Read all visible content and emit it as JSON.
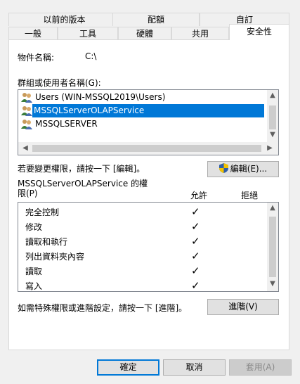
{
  "tabs_back": [
    "以前的版本",
    "配額",
    "自訂"
  ],
  "tabs_front": [
    "一般",
    "工具",
    "硬體",
    "共用",
    "安全性"
  ],
  "object_name_label": "物件名稱:",
  "object_name_value": "C:\\",
  "groups_label": "群組或使用者名稱(G):",
  "groups": [
    {
      "name": "Users (WIN-MSSQL2019\\Users)",
      "selected": false
    },
    {
      "name": "MSSQLServerOLAPService",
      "selected": true
    },
    {
      "name": "MSSQLSERVER",
      "selected": false
    }
  ],
  "change_perm_text": "若要變更權限，請按一下 [編輯]。",
  "edit_button": "編輯(E)...",
  "perm_for_line1": "MSSQLServerOLAPService 的權",
  "perm_for_line2": "限(P)",
  "allow_header": "允許",
  "deny_header": "拒絕",
  "permissions": [
    {
      "name": "完全控制",
      "allow": true,
      "deny": false
    },
    {
      "name": "修改",
      "allow": true,
      "deny": false
    },
    {
      "name": "讀取和執行",
      "allow": true,
      "deny": false
    },
    {
      "name": "列出資料夾內容",
      "allow": true,
      "deny": false
    },
    {
      "name": "讀取",
      "allow": true,
      "deny": false
    },
    {
      "name": "寫入",
      "allow": true,
      "deny": false
    }
  ],
  "advanced_text": "如需特殊權限或進階設定，請按一下 [進階]。",
  "advanced_button": "進階(V)",
  "ok_button": "確定",
  "cancel_button": "取消",
  "apply_button": "套用(A)",
  "icons": {
    "user_group": "users-group-icon",
    "shield": "uac-shield-icon",
    "check": "checkmark-icon"
  }
}
